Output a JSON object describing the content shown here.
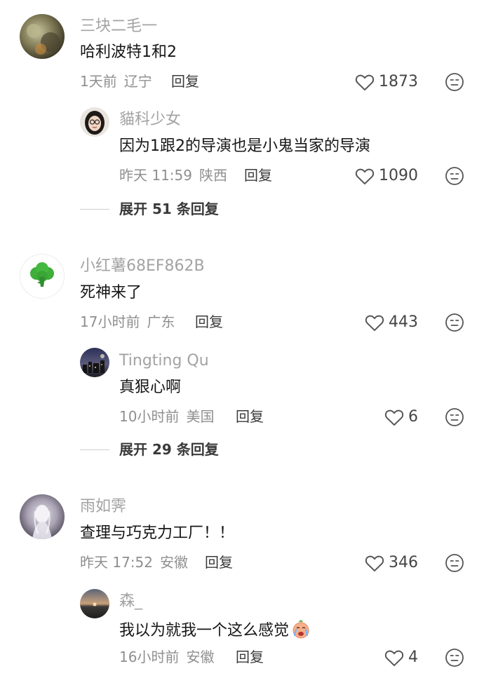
{
  "comments": [
    {
      "username": "三块二毛一",
      "text": "哈利波特1和2",
      "time": "1天前",
      "location": "辽宁",
      "reply_label": "回复",
      "likes": "1873",
      "avatar_icon": "landscape-photo-avatar",
      "replies": [
        {
          "username": "貓科少女",
          "text": "因为1跟2的导演也是小鬼当家的导演",
          "time": "昨天 11:59",
          "location": "陕西",
          "reply_label": "回复",
          "likes": "1090",
          "avatar_icon": "woman-glasses-avatar"
        }
      ],
      "expand_label": "展开 51 条回复"
    },
    {
      "username": "小红薯68EF862B",
      "text": "死神来了",
      "time": "17小时前",
      "location": "广东",
      "reply_label": "回复",
      "likes": "443",
      "avatar_icon": "green-broccoli-avatar",
      "replies": [
        {
          "username": "Tingting Qu",
          "text": "真狠心啊",
          "time": "10小时前",
          "location": "美国",
          "reply_label": "回复",
          "likes": "6",
          "avatar_icon": "city-night-avatar"
        }
      ],
      "expand_label": "展开 29 条回复"
    },
    {
      "username": "雨如霁",
      "text": "查理与巧克力工厂！！",
      "time": "昨天 17:52",
      "location": "安徽",
      "reply_label": "回复",
      "likes": "346",
      "avatar_icon": "ghost-figure-avatar",
      "replies": [
        {
          "username": "森_",
          "text": "我以为就我一个这么感觉",
          "text_emoji": "crying-face-emoji",
          "time": "16小时前",
          "location": "安徽",
          "reply_label": "回复",
          "likes": "4",
          "avatar_icon": "sunset-avatar"
        }
      ]
    }
  ],
  "colors": {
    "username": "#a3a3a3",
    "text": "#161616",
    "meta": "#8f8f8f",
    "icon": "#555555"
  }
}
